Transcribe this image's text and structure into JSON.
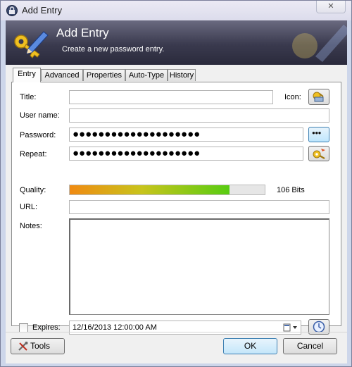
{
  "window": {
    "title": "Add Entry",
    "close_glyph": "✕"
  },
  "banner": {
    "title": "Add Entry",
    "subtitle": "Create a new password entry."
  },
  "tabs": [
    {
      "label": "Entry",
      "active": true
    },
    {
      "label": "Advanced",
      "active": false
    },
    {
      "label": "Properties",
      "active": false
    },
    {
      "label": "Auto-Type",
      "active": false
    },
    {
      "label": "History",
      "active": false
    }
  ],
  "form": {
    "title_label": "Title:",
    "title_value": "",
    "icon_label": "Icon:",
    "username_label": "User name:",
    "username_value": "",
    "password_label": "Password:",
    "password_value": "●●●●●●●●●●●●●●●●●●●●",
    "repeat_label": "Repeat:",
    "repeat_value": "●●●●●●●●●●●●●●●●●●●●",
    "quality_label": "Quality:",
    "quality_fraction": 0.82,
    "quality_text": "106 Bits",
    "url_label": "URL:",
    "url_value": "",
    "notes_label": "Notes:",
    "notes_value": "",
    "expires_label": "Expires:",
    "expires_checked": false,
    "expires_value": "12/16/2013 12:00:00 AM",
    "show_password_glyph": "●●●"
  },
  "buttons": {
    "tools": "Tools",
    "ok": "OK",
    "cancel": "Cancel"
  },
  "icons": {
    "title": "lock-icon",
    "banner": "key-pencil-icon",
    "icon_picker": "key-icon",
    "show_password": "dots-icon",
    "generate_password": "password-generator-icon",
    "expiry_presets": "clock-icon",
    "tools": "tools-icon"
  },
  "colors": {
    "accent_blue": "#3c7fb1",
    "quality_start": "#f08a12",
    "quality_end": "#58cc12"
  }
}
